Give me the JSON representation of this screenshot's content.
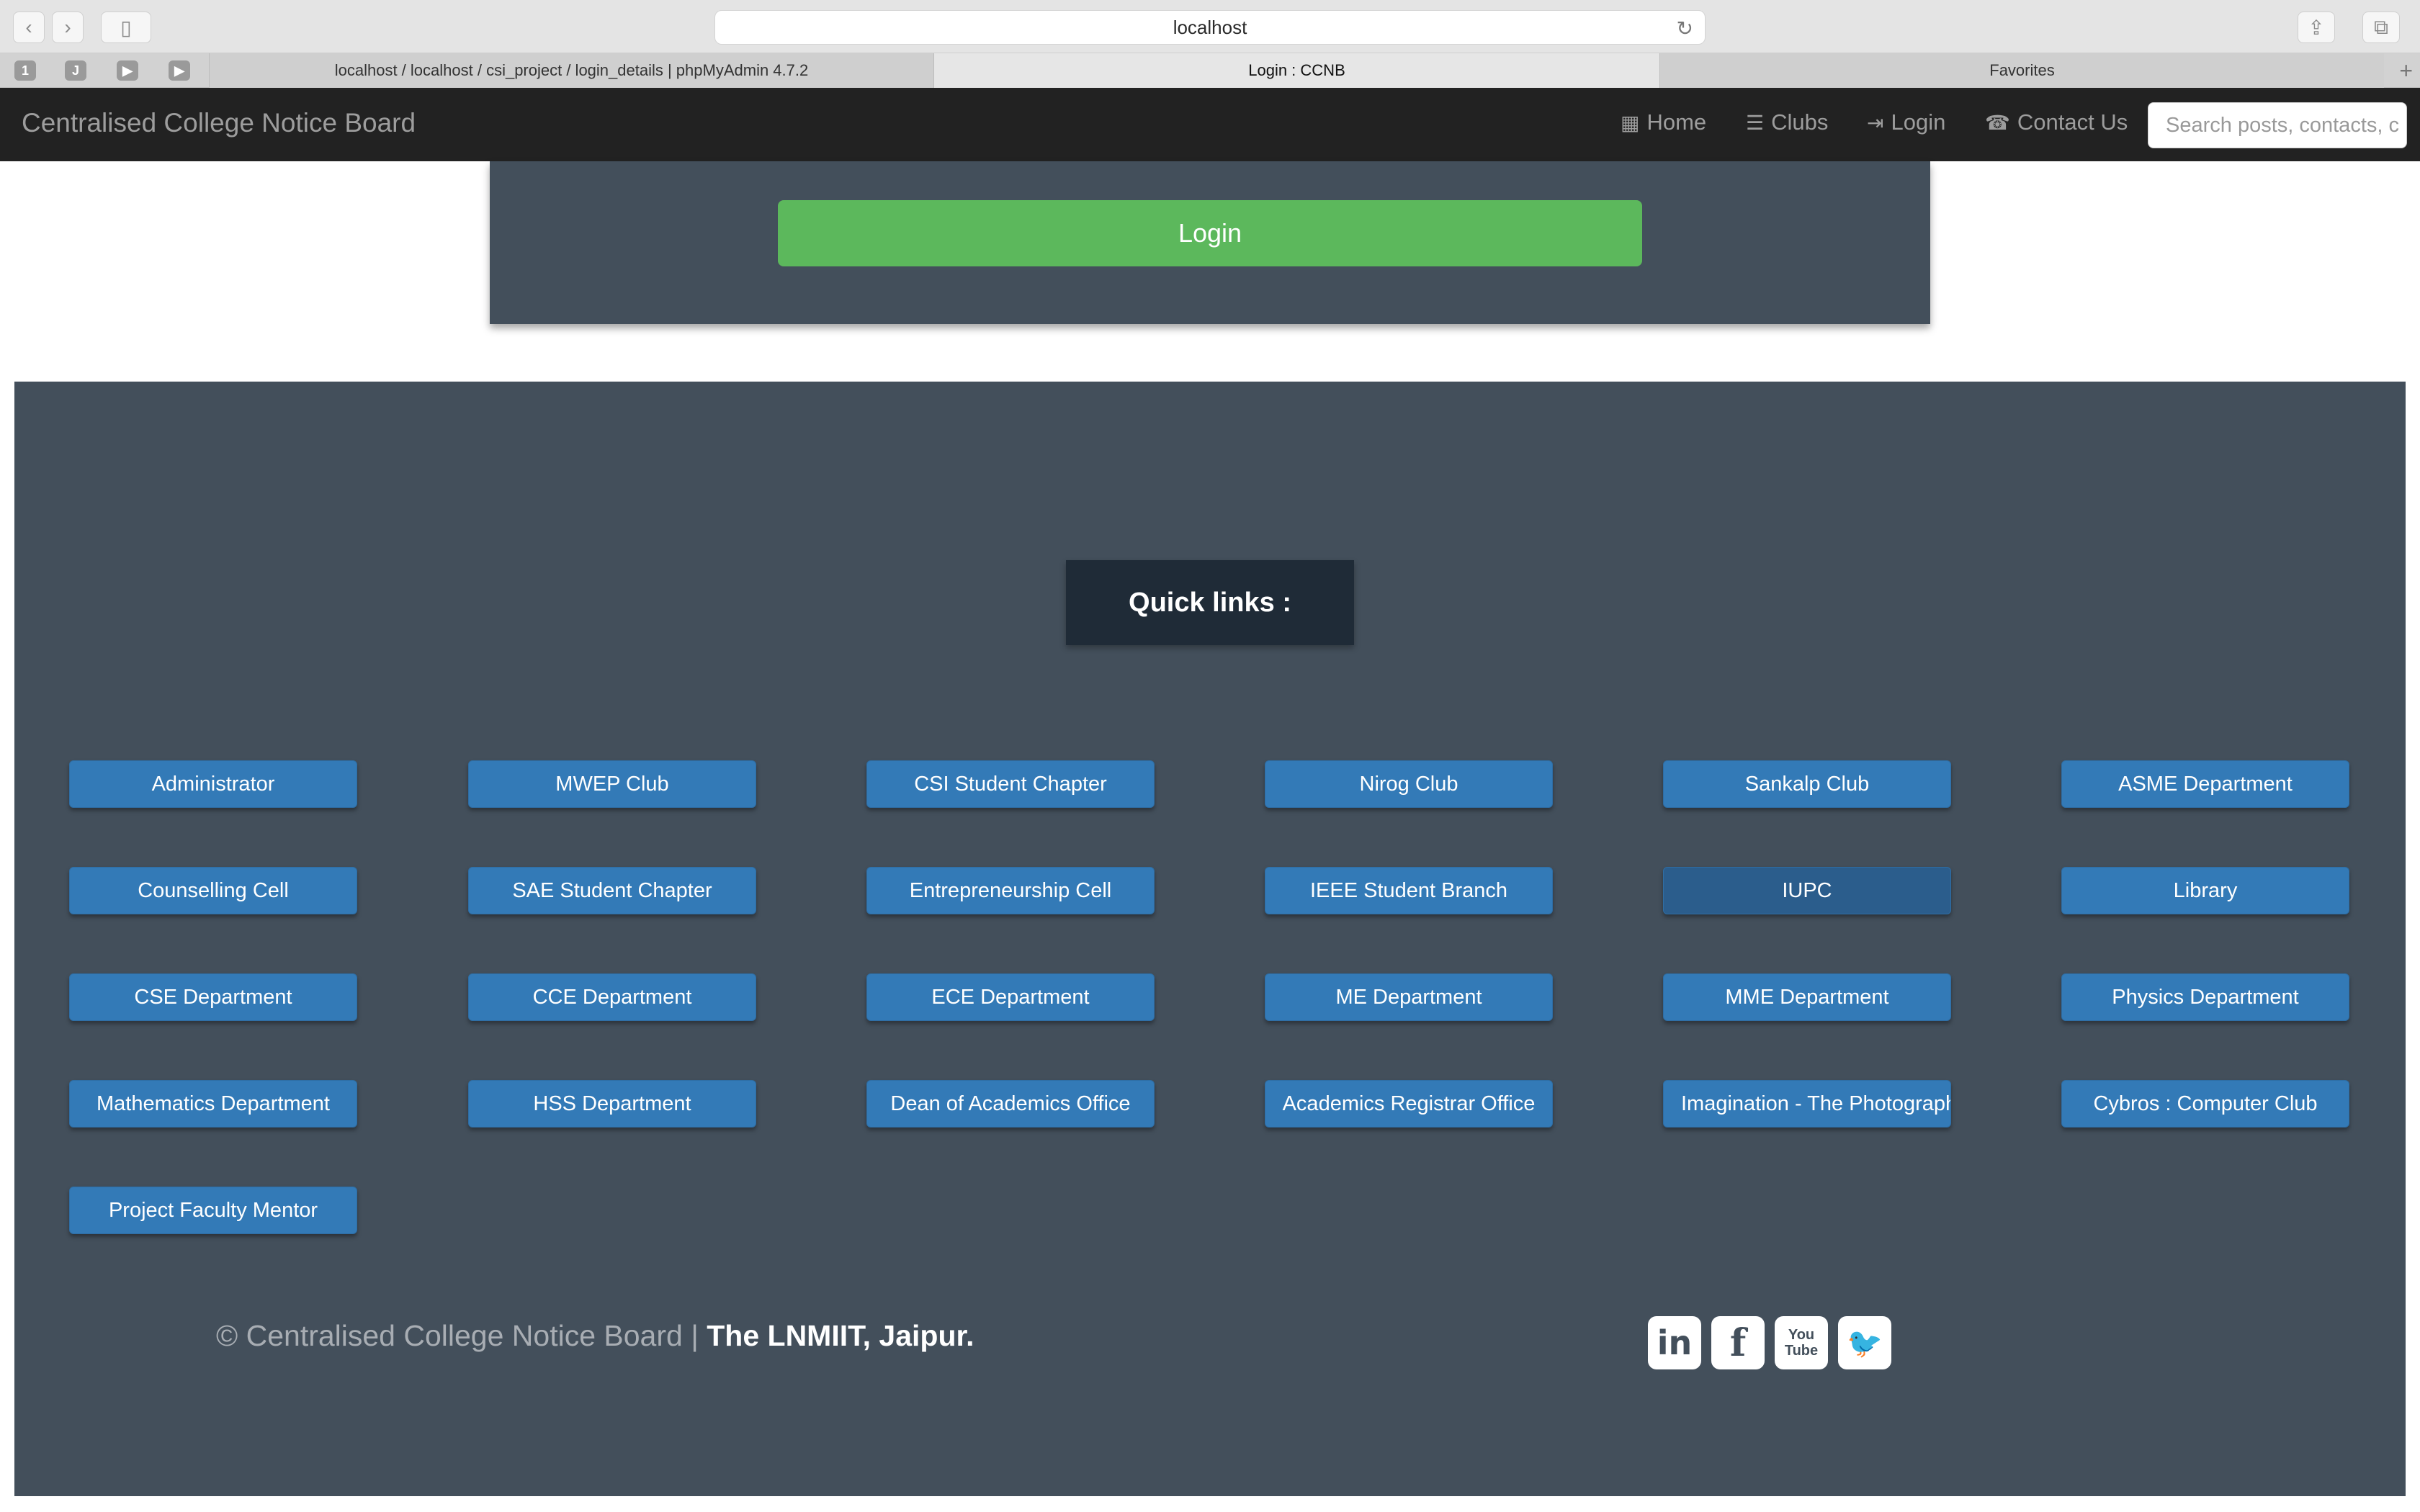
{
  "browser": {
    "url": "localhost",
    "tabs": [
      {
        "label": "localhost / localhost / csi_project / login_details | phpMyAdmin 4.7.2"
      },
      {
        "label": "Login : CCNB"
      },
      {
        "label": "Favorites"
      }
    ],
    "pinned": [
      "1",
      "J",
      "",
      ""
    ]
  },
  "navbar": {
    "brand": "Centralised College Notice Board",
    "items": [
      {
        "label": "Home",
        "icon": "grid-icon"
      },
      {
        "label": "Clubs",
        "icon": "list-icon"
      },
      {
        "label": "Login",
        "icon": "login-icon"
      },
      {
        "label": "Contact Us",
        "icon": "phone-icon"
      }
    ],
    "search_placeholder": "Search posts, contacts, c"
  },
  "login": {
    "button_label": "Login"
  },
  "footer": {
    "quick_links_title": "Quick links :",
    "links": [
      "Administrator",
      "MWEP Club",
      "CSI Student Chapter",
      "Nirog Club",
      "Sankalp Club",
      "ASME Department",
      "Counselling Cell",
      "SAE Student Chapter",
      "Entrepreneurship Cell",
      "IEEE Student Branch",
      "IUPC",
      "Library",
      "CSE Department",
      "CCE Department",
      "ECE Department",
      "ME Department",
      "MME Department",
      "Physics Department",
      "Mathematics Department",
      "HSS Department",
      "Dean of Academics Office",
      "Academics Registrar Office",
      "Imagination - The Photograph",
      "Cybros : Computer Club",
      "Project Faculty Mentor"
    ],
    "copyright_prefix": "© Centralised College Notice Board | ",
    "copyright_strong": "The LNMIIT, Jaipur.",
    "social": [
      {
        "name": "linkedin-icon",
        "text": "in"
      },
      {
        "name": "facebook-icon",
        "text": "f"
      },
      {
        "name": "youtube-icon",
        "text": "You Tube"
      },
      {
        "name": "twitter-icon",
        "text": "🐦"
      }
    ]
  }
}
